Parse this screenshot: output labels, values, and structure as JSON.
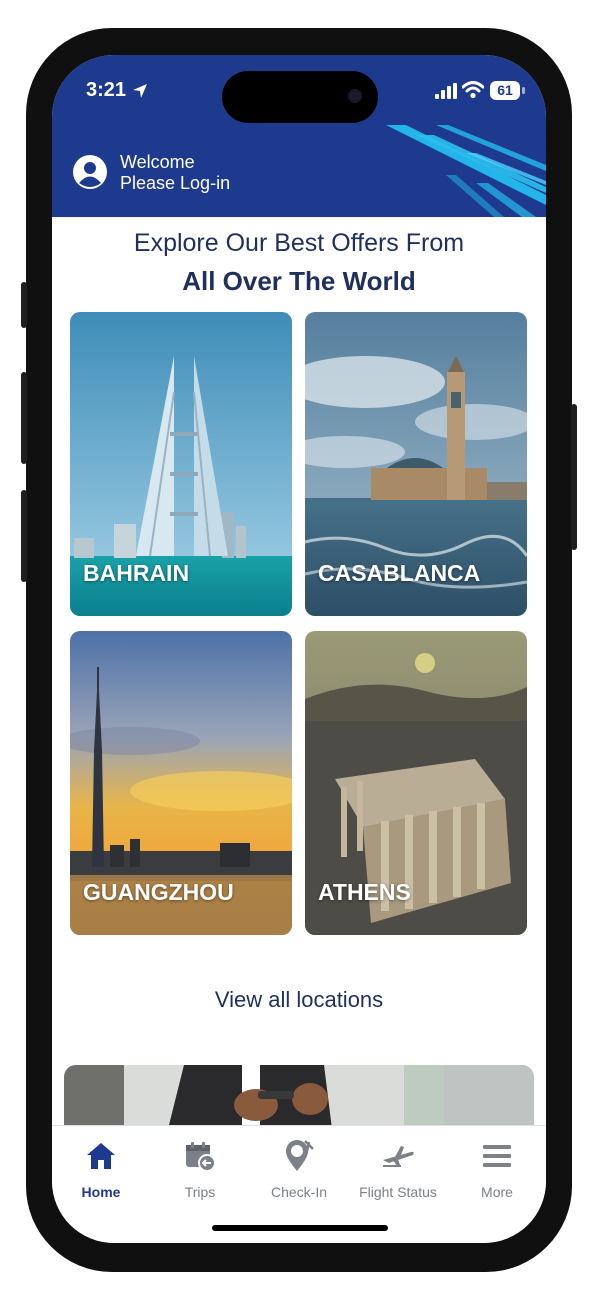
{
  "status_bar": {
    "time": "3:21",
    "battery": "61"
  },
  "header": {
    "welcome": "Welcome",
    "login_prompt": "Please Log-in"
  },
  "offers": {
    "title_line1": "Explore Our Best Offers From",
    "title_line2": "All Over The World",
    "destinations": [
      {
        "name": "BAHRAIN"
      },
      {
        "name": "CASABLANCA"
      },
      {
        "name": "GUANGZHOU"
      },
      {
        "name": "ATHENS"
      }
    ],
    "view_all": "View all locations"
  },
  "tab_bar": {
    "items": [
      {
        "label": "Home",
        "icon": "home-icon",
        "active": true
      },
      {
        "label": "Trips",
        "icon": "calendar-icon",
        "active": false
      },
      {
        "label": "Check-In",
        "icon": "check-in-icon",
        "active": false
      },
      {
        "label": "Flight Status",
        "icon": "airplane-icon",
        "active": false
      },
      {
        "label": "More",
        "icon": "menu-icon",
        "active": false
      }
    ]
  },
  "colors": {
    "brand_blue": "#1e3a8f",
    "accent_cyan": "#23b5ea",
    "text_navy": "#1f2f5e"
  }
}
